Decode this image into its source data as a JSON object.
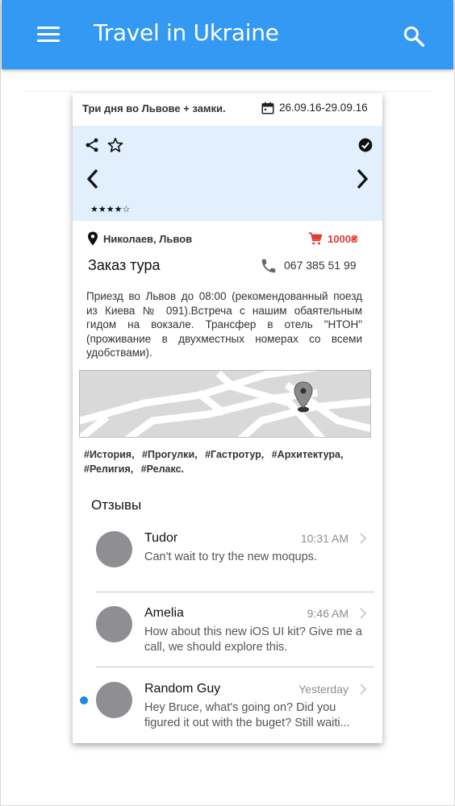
{
  "app": {
    "title": "Travel in Ukraine",
    "brand_color": "#3399f3"
  },
  "tour": {
    "title": "Три дня во Львове + замки.",
    "dates": "26.09.16-29.09.16",
    "rating_text": "★★★★☆",
    "rating_value": 4,
    "rating_max": 5,
    "location": "Николаев, Львов",
    "price": "1000₴",
    "order_title": "Заказ тура",
    "phone": "067 385 51 99",
    "description": "Приезд во Львов до 08:00 (рекомендованный поезд из Киева № 091).Встреча с нашим обаятельным гидом на вокзале. Трансфер в отель \"НТОН\" (проживание в двухместных номерах со всеми удобствами).",
    "tags": "#История, #Прогулки, #Гастротур, #Архитектура, #Религия, #Релакс.",
    "gallery_bg": "#e1f0fc",
    "price_color": "#e53935"
  },
  "reviews": {
    "title": "Отзывы",
    "items": [
      {
        "name": "Tudor",
        "time": "10:31 AM",
        "message": "Can't wait to try the new moqups.",
        "unread": false
      },
      {
        "name": "Amelia",
        "time": "9:46 AM",
        "message": "How about this new iOS UI kit? Give me a call, we should explore this.",
        "unread": false
      },
      {
        "name": "Random Guy",
        "time": "Yesterday",
        "message": "Hey Bruce, what's going on? Did you figured it out with the buget? Still waiti...",
        "unread": true
      }
    ]
  },
  "icons": {
    "menu": "menu-icon",
    "search": "search-icon",
    "calendar": "calendar-icon",
    "share": "share-icon",
    "favorite": "star-outline-icon",
    "check": "check-circle-icon",
    "prev": "chevron-left-icon",
    "next": "chevron-right-icon",
    "location": "location-pin-icon",
    "cart": "cart-icon",
    "phone": "phone-icon",
    "map_pin": "map-pin-icon",
    "disclosure": "chevron-right-icon"
  }
}
